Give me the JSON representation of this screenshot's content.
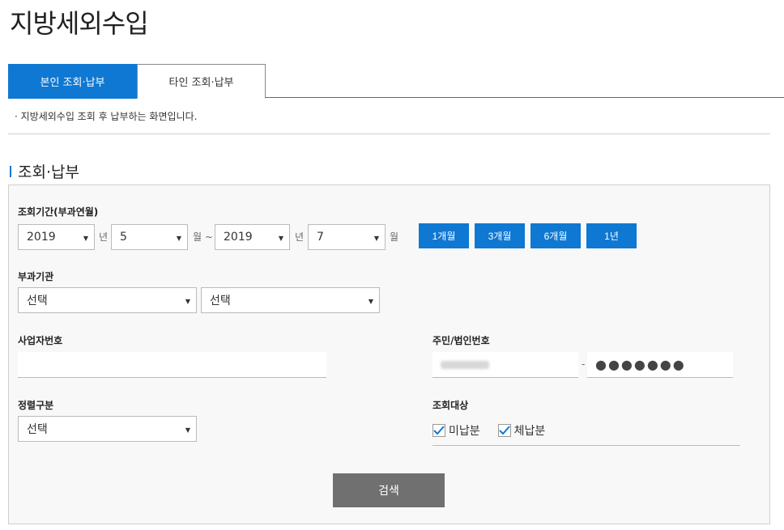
{
  "page": {
    "title": "지방세외수입"
  },
  "tabs": [
    {
      "label": "본인 조회·납부",
      "active": true
    },
    {
      "label": "타인 조회·납부",
      "active": false
    }
  ],
  "notice": {
    "text": "· 지방세외수입 조회 후 납부하는 화면입니다."
  },
  "section": {
    "title": "조회·납부"
  },
  "form": {
    "period": {
      "label": "조회기간(부과연월)",
      "from_year": "2019",
      "from_month": "5",
      "to_year": "2019",
      "to_month": "7",
      "year_unit": "년",
      "month_unit": "월",
      "month_unit_tilde": "월 ~",
      "buttons": [
        "1개월",
        "3개월",
        "6개월",
        "1년"
      ]
    },
    "agency": {
      "label": "부과기관",
      "select1": "선택",
      "select2": "선택"
    },
    "business_no": {
      "label": "사업자번호",
      "value": ""
    },
    "resident_no": {
      "label": "주민/법인번호",
      "dash": "-",
      "masked": "●●●●●●●"
    },
    "sort": {
      "label": "정렬구분",
      "value": "선택"
    },
    "target": {
      "label": "조회대상",
      "options": [
        {
          "label": "미납분",
          "checked": true
        },
        {
          "label": "체납분",
          "checked": true
        }
      ]
    },
    "search_label": "검색"
  },
  "colors": {
    "accent": "#0f78d2",
    "search_button": "#707070",
    "panel_bg": "#f8f8f8"
  },
  "icons": {
    "dropdown": "chevron-down-icon",
    "checkbox": "check-icon"
  }
}
